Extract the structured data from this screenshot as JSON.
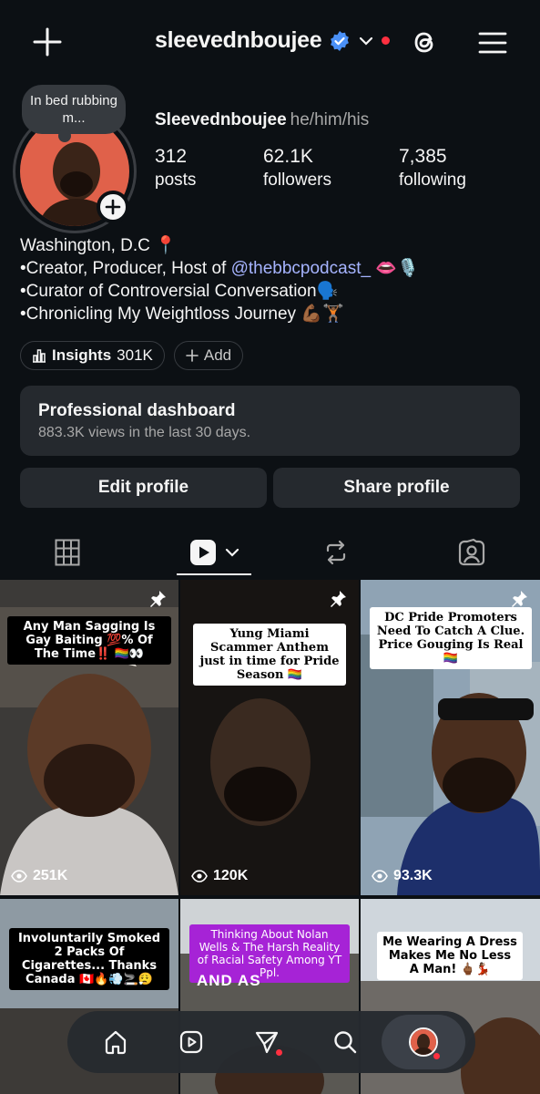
{
  "header": {
    "username": "sleevednboujee"
  },
  "profile": {
    "note": "In bed rubbing m...",
    "display_name": "Sleevednboujee",
    "pronouns": "he/him/his",
    "stats": [
      {
        "value": "312",
        "label": "posts"
      },
      {
        "value": "62.1K",
        "label": "followers"
      },
      {
        "value": "7,385",
        "label": "following"
      }
    ],
    "bio": {
      "line1": "Washington, D.C 📍",
      "line2_prefix": "•Creator, Producer, Host of ",
      "line2_link": "@thebbcpodcast_",
      "line2_suffix": " 👄🎙️",
      "line3": "•Curator of Controversial Conversation🗣️",
      "line4": "•Chronicling My Weightloss Journey 💪🏾🏋🏾"
    },
    "insights_label": "Insights",
    "insights_value": "301K",
    "add_label": "Add",
    "dashboard_title": "Professional dashboard",
    "dashboard_subtitle": "883.3K views in the last 30 days.",
    "edit_label": "Edit profile",
    "share_label": "Share profile"
  },
  "grid": [
    {
      "caption": "Any Man Sagging Is Gay Baiting 💯% Of The Time‼️ 🏳️‍🌈👀",
      "views": "251K",
      "pinned": true
    },
    {
      "caption": "Yung Miami Scammer Anthem just in time for Pride Season 🏳️‍🌈",
      "views": "120K",
      "pinned": true
    },
    {
      "caption": "DC Pride Promoters Need To Catch A Clue. Price Gouging Is Real 🏳️‍🌈",
      "views": "93.3K",
      "pinned": true
    },
    {
      "caption": "Involuntarily Smoked 2 Packs Of Cigarettes... Thanks Canada 🇨🇦🔥💨🚬😮‍💨"
    },
    {
      "caption": "Thinking About Nolan Wells & The Harsh Reality of Racial Safety Among YT Ppl.",
      "overlay": "AND AS"
    },
    {
      "caption": "Me Wearing A Dress Makes Me No Less A Man! 🖕🏾💃🏾"
    }
  ],
  "colors": {
    "background": "#0c1014",
    "card": "#25292e",
    "link": "#a6b4ff",
    "verified": "#4a90f7",
    "notification": "#ff3040"
  }
}
